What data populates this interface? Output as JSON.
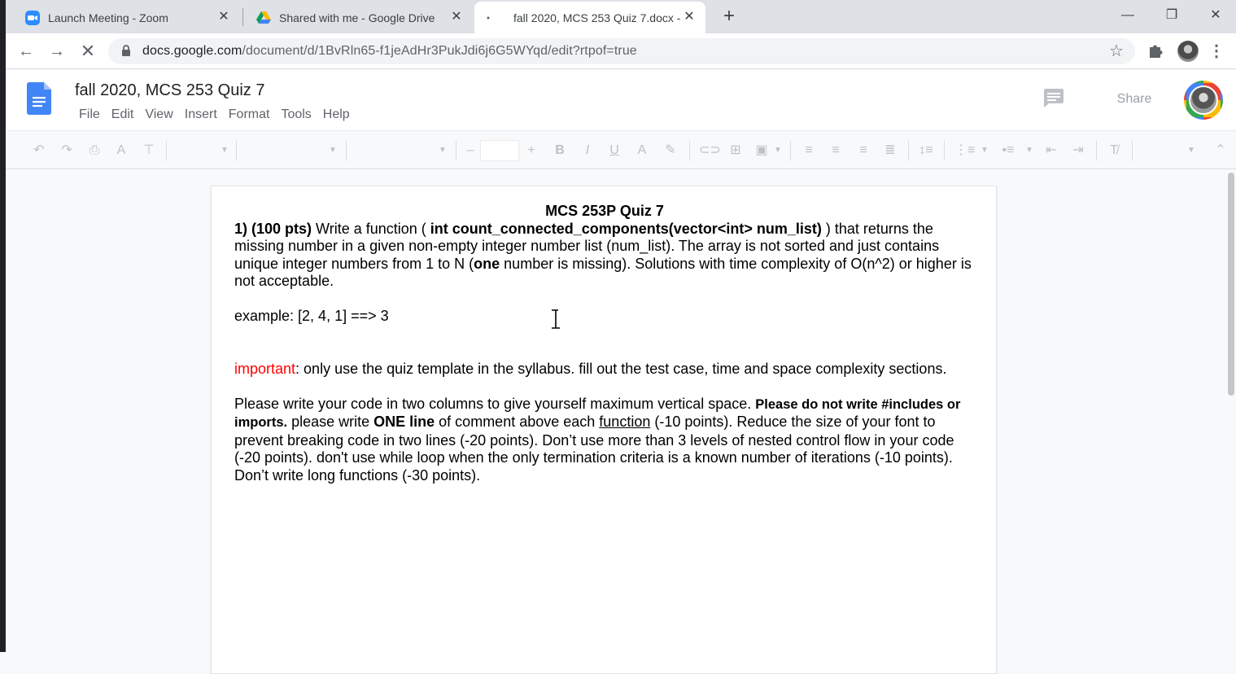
{
  "browser": {
    "tabs": [
      {
        "title": "Launch Meeting - Zoom",
        "icon": "zoom-icon",
        "active": false
      },
      {
        "title": "Shared with me - Google Drive",
        "icon": "google-drive-icon",
        "active": false
      },
      {
        "title": "fall 2020, MCS 253 Quiz 7.docx -",
        "icon": "loading-dot-icon",
        "active": true
      }
    ],
    "url_host": "docs.google.com",
    "url_path": "/document/d/1BvRln65-f1jeAdHr3PukJdi6j6G5WYqd/edit?rtpof=true"
  },
  "docs": {
    "title": "fall 2020, MCS 253 Quiz 7",
    "menus": [
      "File",
      "Edit",
      "View",
      "Insert",
      "Format",
      "Tools",
      "Help"
    ],
    "share_label": "Share"
  },
  "document": {
    "heading": "MCS 253P Quiz 7",
    "q_label": "1) (100 pts)",
    "q_text_1": " Write a function ( ",
    "q_signature": "int count_connected_components(vector<int> num_list)",
    "q_text_2": " ) that returns the missing number in a given non-empty integer number list (num_list). The array is not sorted and just contains unique integer numbers from 1 to N (",
    "q_one": "one",
    "q_text_3": " number is missing). Solutions with time complexity of O(n^2) or higher is not acceptable.",
    "example": "example: [2, 4, 1] ==> 3",
    "important_label": "important",
    "important_text": ": only use the quiz template in the syllabus. fill out the test case, time and space complexity sections.",
    "p3_a": "Please write your code in two columns to give yourself maximum vertical space. ",
    "p3_bold1": "Please do not write #includes or imports.",
    "p3_b": " please write ",
    "p3_bold2": "ONE line",
    "p3_c": " of comment above each ",
    "p3_underline": "function",
    "p3_d": " (-10 points). Reduce the size of your font to prevent breaking code in two lines (-20 points). Don’t use more than 3 levels of nested control flow in your code (-20 points). don't use while loop when the only termination criteria is a known number of iterations (-10 points). Don’t write long functions (-30 points)."
  }
}
